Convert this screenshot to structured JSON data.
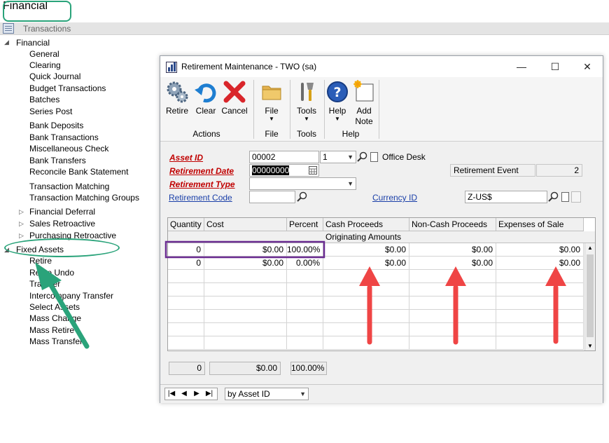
{
  "app": {
    "title": "Financial",
    "toolbar_label": "Transactions"
  },
  "nav": {
    "financial": {
      "label": "Financial",
      "items": [
        "General",
        "Clearing",
        "Quick Journal",
        "Budget Transactions",
        "Batches",
        "Series Post",
        "Bank Deposits",
        "Bank Transactions",
        "Miscellaneous Check",
        "Bank Transfers",
        "Reconcile Bank Statement",
        "Transaction Matching",
        "Transaction Matching Groups"
      ]
    },
    "collapsed": [
      "Financial Deferral",
      "Sales Retroactive",
      "Purchasing Retroactive"
    ],
    "fixed_assets": {
      "label": "Fixed Assets",
      "items": [
        "Retire",
        "Retire Undo",
        "Transfer",
        "Intercompany Transfer",
        "Select Assets",
        "Mass Change",
        "Mass Retire",
        "Mass Transfer"
      ]
    }
  },
  "window": {
    "title": "Retirement Maintenance  -  TWO (sa)",
    "controls": {
      "minimize": "—",
      "maximize": "☐",
      "close": "✕"
    }
  },
  "ribbon": {
    "buttons": {
      "retire": "Retire",
      "clear": "Clear",
      "cancel": "Cancel",
      "file": "File",
      "tools": "Tools",
      "help": "Help",
      "add_note_1": "Add",
      "add_note_2": "Note"
    },
    "groups": {
      "actions": "Actions",
      "file": "File",
      "tools": "Tools",
      "help": "Help"
    }
  },
  "form": {
    "asset_id_label": "Asset ID",
    "asset_id": "00002",
    "asset_suffix": "1",
    "asset_desc": "Office Desk",
    "retirement_date_label": "Retirement Date",
    "retirement_date": "00000000",
    "retirement_event_label": "Retirement Event",
    "retirement_event": "2",
    "retirement_type_label": "Retirement Type",
    "retirement_type": "",
    "retirement_code_label": "Retirement Code",
    "retirement_code": "",
    "currency_id_label": "Currency ID",
    "currency_id": "Z-US$"
  },
  "grid": {
    "headers": [
      "Quantity",
      "Cost",
      "Percent",
      "Cash Proceeds",
      "Non-Cash Proceeds",
      "Expenses of Sale"
    ],
    "subheader": "Originating Amounts",
    "rows": [
      [
        "0",
        "$0.00",
        "100.00%",
        "$0.00",
        "$0.00",
        "$0.00"
      ],
      [
        "0",
        "$0.00",
        "0.00%",
        "$0.00",
        "$0.00",
        "$0.00"
      ]
    ]
  },
  "totals": {
    "quantity": "0",
    "cost": "$0.00",
    "percent": "100.00%"
  },
  "footer": {
    "sort_by": "by Asset ID",
    "nav_glyphs": [
      "|◀",
      "◀",
      "▶",
      "▶|"
    ]
  },
  "annotation_colors": {
    "green": "#2aa37a",
    "purple": "#6a2c91",
    "red": "#ef4545"
  }
}
